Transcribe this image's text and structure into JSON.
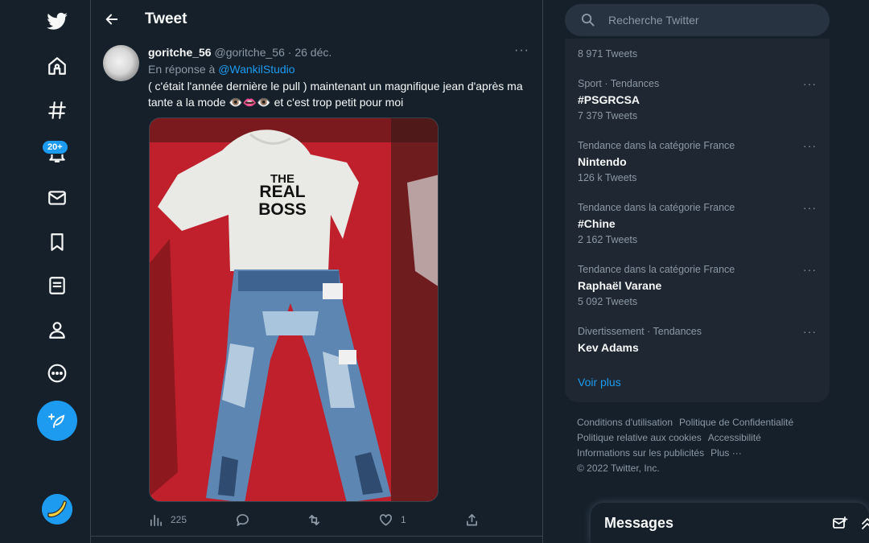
{
  "header": {
    "title": "Tweet"
  },
  "nav": {
    "notifications_badge": "20+",
    "items": [
      "home-icon",
      "explore-icon",
      "notifications-icon",
      "messages-icon",
      "bookmarks-icon",
      "lists-icon",
      "profile-icon",
      "more-icon"
    ]
  },
  "tweet": {
    "name": "goritche_56",
    "handle": "@goritche_56",
    "date": "· 26 déc.",
    "reply_prefix": "En réponse à",
    "reply_handle": "@WankilStudio",
    "text": "( c'était l'année dernière le pull ) maintenant un magnifique jean d'après ma tante a la mode 👁️👄👁️ et c'est trop petit pour moi",
    "media_print": "THE\nREAL\nBOSS",
    "stats": {
      "views": "225",
      "likes": "1"
    }
  },
  "search": {
    "placeholder": "Recherche Twitter"
  },
  "trends": {
    "first_count": "8 971 Tweets",
    "items": [
      {
        "context": "Sport · Tendances",
        "name": "#PSGRCSA",
        "count": "7 379 Tweets"
      },
      {
        "context": "Tendance dans la catégorie France",
        "name": "Nintendo",
        "count": "126 k Tweets"
      },
      {
        "context": "Tendance dans la catégorie France",
        "name": "#Chine",
        "count": "2 162 Tweets"
      },
      {
        "context": "Tendance dans la catégorie France",
        "name": "Raphaël Varane",
        "count": "5 092 Tweets"
      },
      {
        "context": "Divertissement · Tendances",
        "name": "Kev Adams",
        "count": ""
      }
    ],
    "show_more": "Voir plus"
  },
  "footer": {
    "terms": "Conditions d'utilisation",
    "privacy": "Politique de Confidentialité",
    "cookies": "Politique relative aux cookies",
    "accessibility": "Accessibilité",
    "ads": "Informations sur les publicités",
    "more": "Plus ···",
    "copyright": "© 2022 Twitter, Inc."
  },
  "messages": {
    "title": "Messages"
  },
  "colors": {
    "background": "#15202b",
    "accent": "#1d9bf0",
    "muted": "#8b98a5",
    "panel": "#1e2732"
  }
}
